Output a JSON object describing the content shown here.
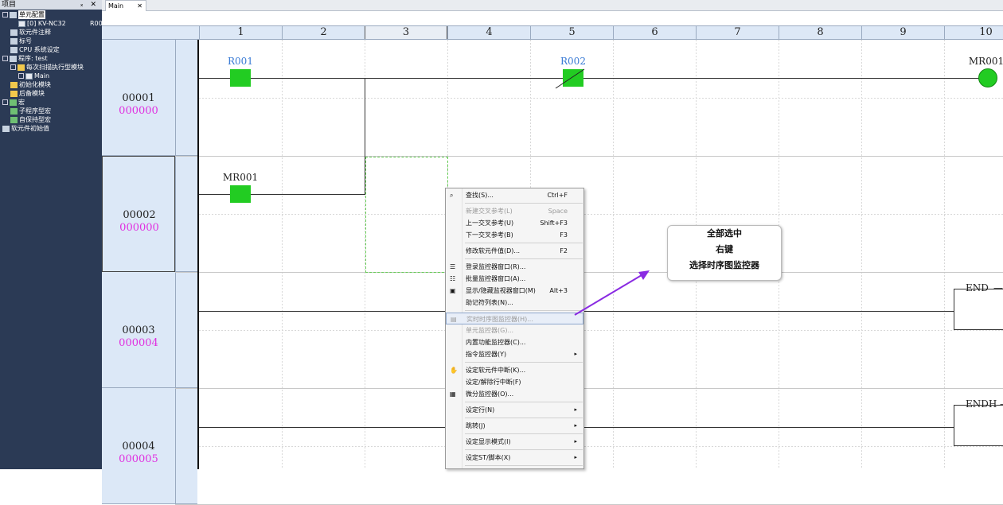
{
  "project_panel": {
    "title": "项目",
    "controls": "ₓ ✕",
    "tree": [
      {
        "label": "单元配置",
        "indent": 0,
        "icon": "grid",
        "toggle": "-",
        "selected": true
      },
      {
        "label": "[0]  KV-NC32",
        "extra": "R00",
        "indent": 2,
        "icon": "doc"
      },
      {
        "label": "软元件注释",
        "indent": 1,
        "icon": "grid"
      },
      {
        "label": "标号",
        "indent": 1,
        "icon": "grid"
      },
      {
        "label": "CPU 系统设定",
        "indent": 1,
        "icon": "grid"
      },
      {
        "label": "程序: test",
        "indent": 0,
        "icon": "grid",
        "toggle": "-"
      },
      {
        "label": "每次扫描执行型模块",
        "indent": 1,
        "icon": "folder",
        "toggle": "-"
      },
      {
        "label": "Main",
        "indent": 2,
        "icon": "doc",
        "toggle": "+"
      },
      {
        "label": "初始化模块",
        "indent": 1,
        "icon": "folder"
      },
      {
        "label": "后备模块",
        "indent": 1,
        "icon": "folder"
      },
      {
        "label": "宏",
        "indent": 0,
        "icon": "macro",
        "toggle": "-"
      },
      {
        "label": "子程序型宏",
        "indent": 1,
        "icon": "macro"
      },
      {
        "label": "自保持型宏",
        "indent": 1,
        "icon": "macro"
      },
      {
        "label": "软元件初始值",
        "indent": 0,
        "icon": "grid"
      }
    ]
  },
  "tab": {
    "label": "Main",
    "close": "✕"
  },
  "columns": [
    "1",
    "2",
    "3",
    "4",
    "5",
    "6",
    "7",
    "8",
    "9",
    "10"
  ],
  "active_column": "3",
  "rows": [
    {
      "number": "00001",
      "step": "000000"
    },
    {
      "number": "00002",
      "step": "000000"
    },
    {
      "number": "00003",
      "step": "000004"
    },
    {
      "number": "00004",
      "step": "000005"
    }
  ],
  "ladder": {
    "contact1": "R001",
    "contact2": "R002",
    "coil": "MR001",
    "contact3": "MR001",
    "end1": "END",
    "end2": "ENDH",
    "dash": "—"
  },
  "context_menu": [
    {
      "label": "查找(S)...",
      "shortcut": "Ctrl+F",
      "icon": "binoculars-icon",
      "glyph": "⌕"
    },
    {
      "sep": true
    },
    {
      "label": "新建交叉参考(L)",
      "shortcut": "Space",
      "disabled": true
    },
    {
      "label": "上一交叉参考(U)",
      "shortcut": "Shift+F3"
    },
    {
      "label": "下一交叉参考(B)",
      "shortcut": "F3"
    },
    {
      "sep": true
    },
    {
      "label": "修改软元件值(D)...",
      "shortcut": "F2"
    },
    {
      "sep": true
    },
    {
      "label": "登录监控器窗口(R)...",
      "icon": "list-icon",
      "glyph": "☰"
    },
    {
      "label": "批量监控器窗口(A)...",
      "icon": "list-icon",
      "glyph": "☷"
    },
    {
      "label": "显示/隐藏监视器窗口(M)",
      "shortcut": "Alt+3",
      "icon": "monitor-icon",
      "glyph": "▣"
    },
    {
      "label": "助记符列表(N)..."
    },
    {
      "sep": true
    },
    {
      "label": "实时时序图监控器(H)...",
      "disabled": true,
      "highlighted": true,
      "icon": "timing-chart-icon",
      "glyph": "▤"
    },
    {
      "label": "单元监控器(G)...",
      "disabled": true
    },
    {
      "label": "内置功能监控器(C)..."
    },
    {
      "label": "指令监控器(Y)",
      "arrow": "▸"
    },
    {
      "sep": true
    },
    {
      "label": "设定软元件中断(K)...",
      "icon": "hand-icon",
      "glyph": "✋"
    },
    {
      "label": "设定/解除行中断(F)"
    },
    {
      "label": "微分监控器(O)...",
      "icon": "diff-monitor-icon",
      "glyph": "▦"
    },
    {
      "sep": true
    },
    {
      "label": "设定行(N)",
      "arrow": "▸"
    },
    {
      "sep": true
    },
    {
      "label": "跳转(J)",
      "arrow": "▸"
    },
    {
      "sep": true
    },
    {
      "label": "设定显示模式(I)",
      "arrow": "▸"
    },
    {
      "sep": true
    },
    {
      "label": "设定ST/脚本(X)",
      "arrow": "▸"
    },
    {
      "sep": true
    }
  ],
  "callout": {
    "line1": "全部选中",
    "line2": "右键",
    "line3": "选择时序图监控器"
  },
  "colors": {
    "contact": "#22cc22",
    "label_blue": "#3a7bd5",
    "step_magenta": "#e030e0",
    "arrow": "#8a2be2"
  }
}
